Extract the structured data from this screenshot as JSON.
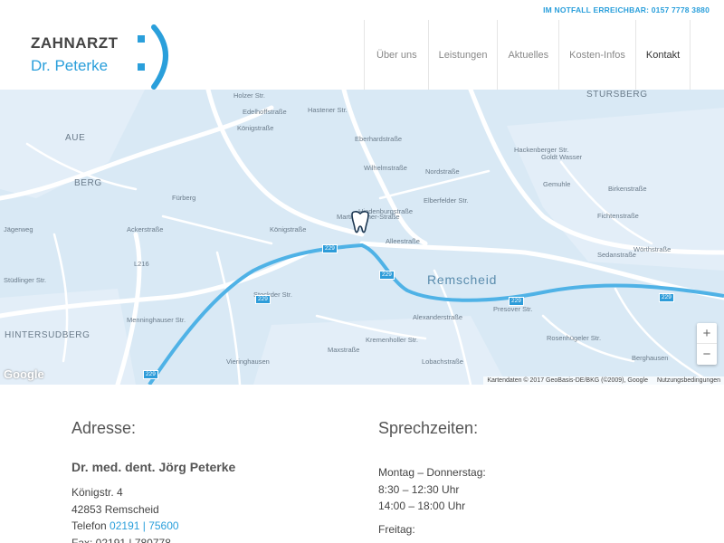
{
  "header": {
    "emergency": "IM NOTFALL ERREICHBAR: 0157 7778 3880",
    "logo_line1": "ZAHNARZT",
    "logo_line2": "Dr. Peterke",
    "logo_mark": ":)"
  },
  "nav": {
    "items": [
      "Über uns",
      "Leistungen",
      "Aktuelles",
      "Kosten-Infos",
      "Kontakt"
    ],
    "active": "Kontakt"
  },
  "map": {
    "street_labels": [
      "Holzer Str.",
      "Hastener Str.",
      "Edelhoffstraße",
      "Königstraße",
      "Eberhardstraße",
      "Wilhelmstraße",
      "Nordstraße",
      "Elberfelder Str.",
      "Hindenburgstraße",
      "Martin-Luther-Straße",
      "Alleestraße",
      "Königstraße",
      "Stockder Str.",
      "Fürberg",
      "Ackerstraße",
      "Menninghauser Str.",
      "L216",
      "Vieringhausen",
      "Alexanderstraße",
      "Presover Str.",
      "Kremenholler Str.",
      "Maxstraße",
      "Lobachstraße",
      "Birkenstraße",
      "Fichtenstraße",
      "Sedanstraße",
      "Wörthstraße",
      "Hackenberger Str.",
      "Goldt Wasser",
      "Stüdlinger Str.",
      "Jägerweg",
      "Rosenhügeler Str.",
      "Berghausen",
      "Gemuhle"
    ],
    "city_labels": [
      "AUE",
      "BERG",
      "HINTERSUDBERG",
      "STURSBERG"
    ],
    "city": "Remscheid",
    "route_shields": [
      "229",
      "229",
      "229",
      "229",
      "229",
      "229"
    ],
    "zoom_in": "+",
    "zoom_out": "−",
    "google": "Google",
    "attribution": "Kartendaten © 2017 GeoBasis-DE/BKG (©2009), Google",
    "terms": "Nutzungsbedingungen",
    "marker_icon": "tooth-icon",
    "colors": {
      "water": "#d9e9f5",
      "roads": "#ffffff",
      "highway": "#2d9cd9"
    }
  },
  "address": {
    "heading": "Adresse:",
    "name": "Dr. med. dent. Jörg Peterke",
    "street": "Königstr. 4",
    "city": "42853 Remscheid",
    "phone_label": "Telefon",
    "phone": "02191 | 75600",
    "fax": "Fax: 02191 | 780778"
  },
  "hours": {
    "heading": "Sprechzeiten:",
    "days1": "Montag – Donnerstag:",
    "slot1": "8:30 – 12:30 Uhr",
    "slot2": "14:00 – 18:00 Uhr",
    "days2": "Freitag:"
  },
  "colors": {
    "accent": "#2a9fdb",
    "text": "#444444"
  }
}
